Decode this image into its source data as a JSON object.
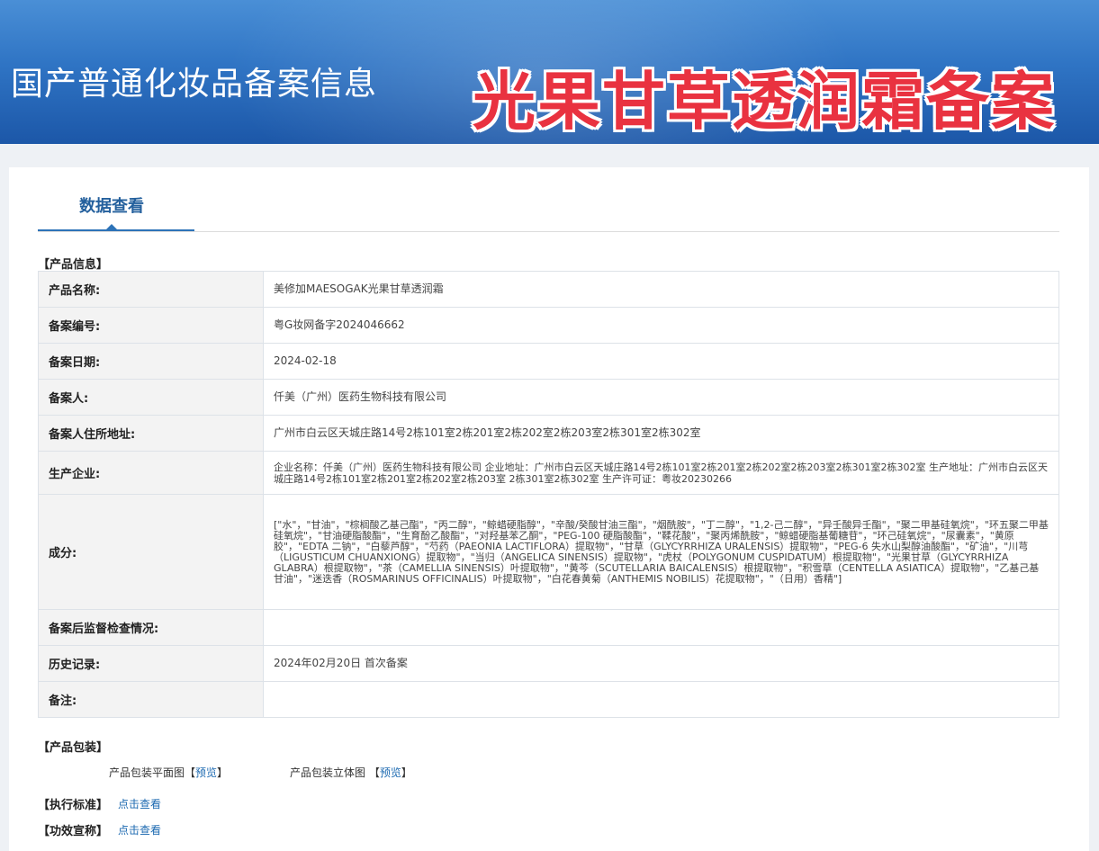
{
  "banner": {
    "title": "国产普通化妆品备案信息",
    "overlay": "光果甘草透润霜备案"
  },
  "tabs": {
    "active": "数据查看"
  },
  "sections": {
    "product_info": "【产品信息】",
    "packaging": "【产品包装】",
    "standard": "【执行标准】",
    "efficacy": "【功效宣称】"
  },
  "info_rows": [
    {
      "label": "产品名称:",
      "value": "美修加MAESOGAK光果甘草透润霜"
    },
    {
      "label": "备案编号:",
      "value": "粤G妆网备字2024046662"
    },
    {
      "label": "备案日期:",
      "value": "2024-02-18"
    },
    {
      "label": "备案人:",
      "value": "仟美（广州）医药生物科技有限公司"
    },
    {
      "label": "备案人住所地址:",
      "value": "广州市白云区天城庄路14号2栋101室2栋201室2栋202室2栋203室2栋301室2栋302室"
    },
    {
      "label": "生产企业:",
      "value": "企业名称：仟美（广州）医药生物科技有限公司 企业地址：广州市白云区天城庄路14号2栋101室2栋201室2栋202室2栋203室2栋301室2栋302室 生产地址：广州市白云区天城庄路14号2栋101室2栋201室2栋202室2栋203室 2栋301室2栋302室 生产许可证：粤妆20230266"
    },
    {
      "label": "成分:",
      "value": "[\"水\"，\"甘油\"，\"棕榈酸乙基己酯\"，\"丙二醇\"，\"鲸蜡硬脂醇\"，\"辛酸/癸酸甘油三酯\"，\"烟酰胺\"，\"丁二醇\"，\"1,2-己二醇\"，\"异壬酸异壬酯\"，\"聚二甲基硅氧烷\"，\"环五聚二甲基硅氧烷\"，\"甘油硬脂酸酯\"，\"生育酚乙酸酯\"，\"对羟基苯乙酮\"，\"PEG-100 硬脂酸酯\"，\"鞣花酸\"，\"聚丙烯酰胺\"，\"鲸蜡硬脂基葡糖苷\"，\"环己硅氧烷\"，\"尿囊素\"，\"黄原胶\"，\"EDTA 二钠\"，\"白藜芦醇\"，\"芍药（PAEONIA LACTIFLORA）提取物\"，\"甘草（GLYCYRRHIZA URALENSIS）提取物\"，\"PEG-6 失水山梨醇油酸酯\"，\"矿油\"，\"川芎（LIGUSTICUM CHUANXIONG）提取物\"，\"当归（ANGELICA SINENSIS）提取物\"，\"虎杖（POLYGONUM CUSPIDATUM）根提取物\"，\"光果甘草（GLYCYRRHIZA GLABRA）根提取物\"，\"茶（CAMELLIA SINENSIS）叶提取物\"，\"黄芩（SCUTELLARIA BAICALENSIS）根提取物\"，\"积雪草（CENTELLA ASIATICA）提取物\"，\"乙基己基甘油\"，\"迷迭香（ROSMARINUS OFFICINALIS）叶提取物\"，\"白花春黄菊（ANTHEMIS NOBILIS）花提取物\"，\"（日用）香精\"]"
    },
    {
      "label": "备案后监督检查情况:",
      "value": ""
    },
    {
      "label": "历史记录:",
      "value": "2024年02月20日 首次备案"
    },
    {
      "label": "备注:",
      "value": ""
    }
  ],
  "packaging": {
    "flat_label": "产品包装平面图",
    "flat_link": "预览",
    "solid_label": "产品包装立体图",
    "solid_link": "预览"
  },
  "links": {
    "standard": "点击查看",
    "efficacy": "点击查看"
  },
  "colors": {
    "banner": "#2f74c4",
    "tab_accent": "#2d73b8",
    "overlay_text": "#e93240",
    "link": "#1d6ab1"
  }
}
